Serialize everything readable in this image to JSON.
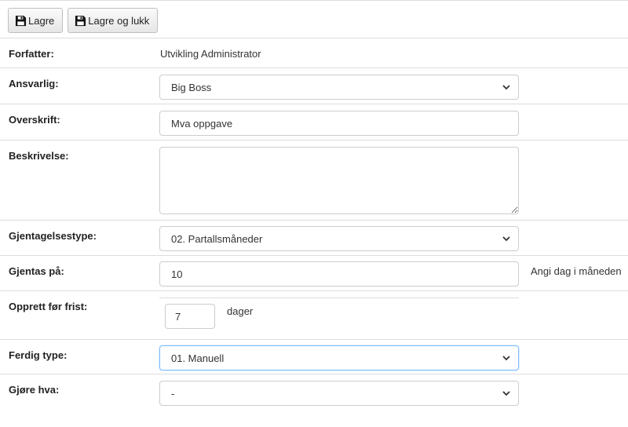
{
  "toolbar": {
    "save_label": "Lagre",
    "save_close_label": "Lagre og lukk",
    "save_icon": "floppy-disk-icon"
  },
  "form": {
    "author": {
      "label": "Forfatter:",
      "value": "Utvikling Administrator"
    },
    "responsible": {
      "label": "Ansvarlig:",
      "value": "Big Boss"
    },
    "heading": {
      "label": "Overskrift:",
      "value": "Mva oppgave"
    },
    "description": {
      "label": "Beskrivelse:",
      "value": ""
    },
    "repeat_type": {
      "label": "Gjentagelsestype:",
      "value": "02. Partallsmåneder"
    },
    "repeat_on": {
      "label": "Gjentas på:",
      "value": "10",
      "hint": "Angi dag i måneden"
    },
    "create_before": {
      "label": "Opprett før frist:",
      "value": "7",
      "unit": "dager"
    },
    "finish_type": {
      "label": "Ferdig type:",
      "value": "01. Manuell"
    },
    "do_what": {
      "label": "Gjøre hva:",
      "value": "-"
    }
  },
  "colors": {
    "border": "#dddddd",
    "input_border": "#cccccc",
    "focus_border": "#80bdff"
  }
}
